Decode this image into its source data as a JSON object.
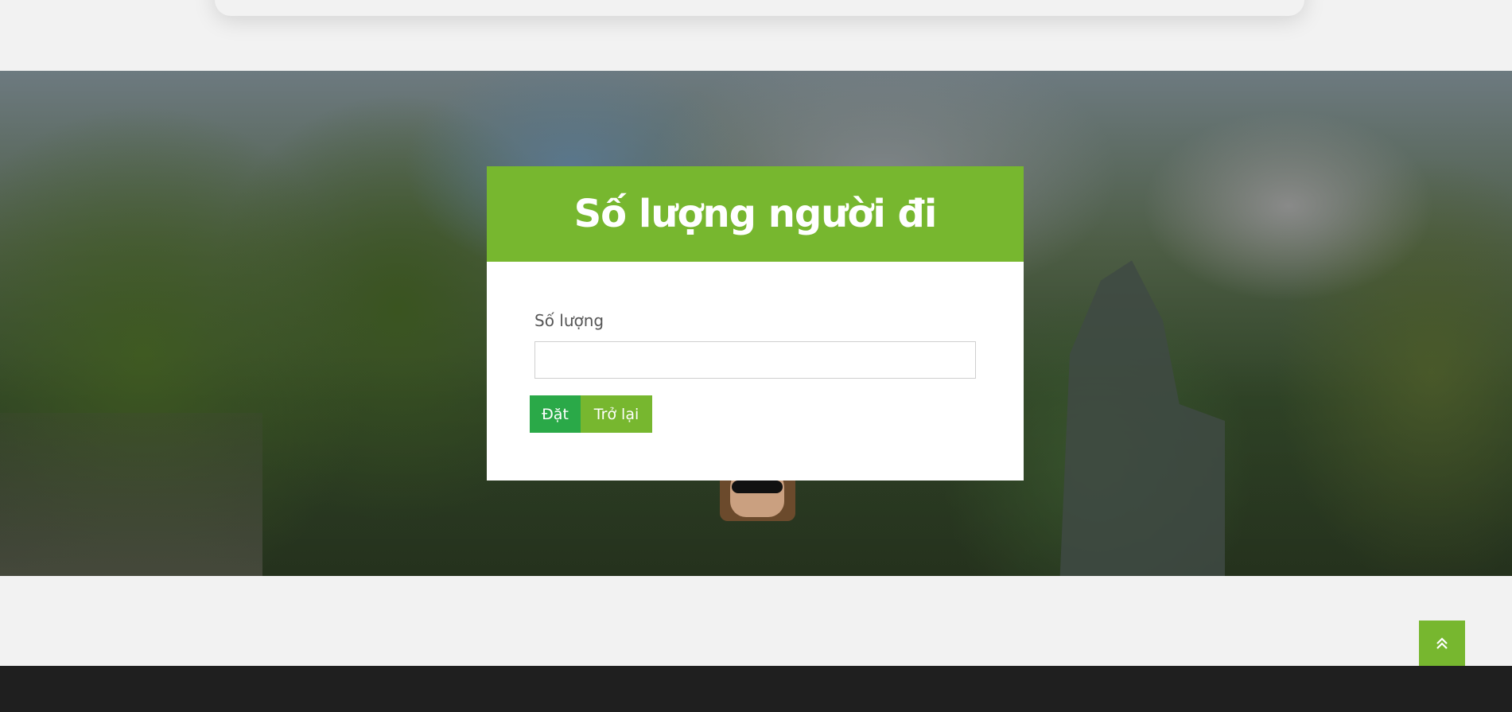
{
  "modal": {
    "title": "Số lượng người đi",
    "field_label": "Số lượng",
    "quantity_value": "",
    "quantity_placeholder": "",
    "submit_label": "Đặt",
    "back_label": "Trở lại"
  },
  "scroll_top": {
    "icon": "double-chevron-up-icon"
  },
  "colors": {
    "accent": "#77b72f",
    "submit": "#2aa948",
    "footer": "#1f1f1f",
    "page_bg": "#f2f2f2"
  }
}
